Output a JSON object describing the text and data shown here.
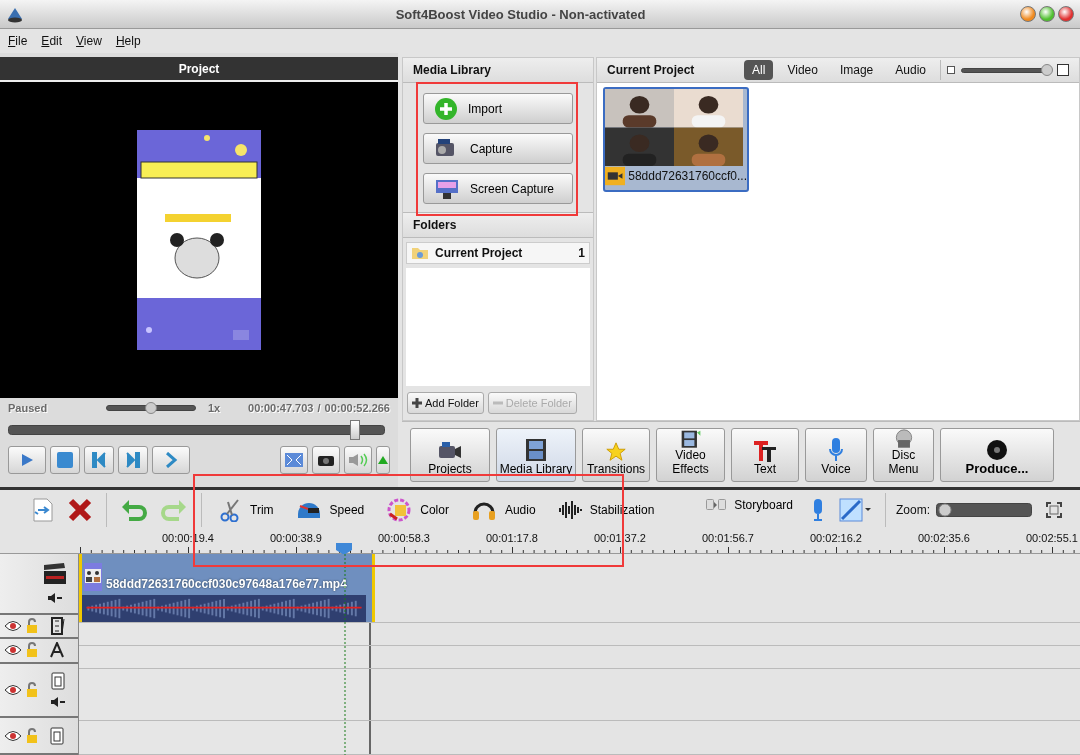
{
  "window": {
    "title": "Soft4Boost Video Studio - Non-activated"
  },
  "menu": [
    "File",
    "Edit",
    "View",
    "Help"
  ],
  "preview": {
    "title": "Project",
    "status": "Paused",
    "speed": {
      "level": 0.5
    },
    "speed_label": "1x",
    "current_time": "00:00:47.703",
    "separator": "/",
    "total_time": "00:00:52.266",
    "seek": {
      "level": 0.92
    }
  },
  "media_library": {
    "title": "Media Library",
    "buttons": [
      {
        "label": "Import",
        "kind": "import"
      },
      {
        "label": "Capture",
        "kind": "capture"
      },
      {
        "label": "Screen Capture",
        "kind": "screen"
      }
    ],
    "folders_title": "Folders",
    "folders": [
      {
        "name": "Current Project",
        "count": "1"
      }
    ],
    "folder_buttons": [
      {
        "label": "Add Folder",
        "kind": "add",
        "disabled": false
      },
      {
        "label": "Delete Folder",
        "kind": "delete",
        "disabled": true
      }
    ]
  },
  "current_project": {
    "title": "Current Project",
    "filters": [
      {
        "label": "All",
        "selected": true
      },
      {
        "label": "Video",
        "selected": false
      },
      {
        "label": "Image",
        "selected": false
      },
      {
        "label": "Audio",
        "selected": false
      }
    ],
    "thumb_size": {
      "level": 0.96
    },
    "items": [
      {
        "name": "58ddd72631760ccf0...",
        "selected": true
      }
    ]
  },
  "modules": [
    {
      "label": "Projects",
      "kind": "projects",
      "selected": false
    },
    {
      "label": "Media Library",
      "kind": "library",
      "selected": true
    },
    {
      "label": "Transitions",
      "kind": "transitions",
      "selected": false
    },
    {
      "label": "Video Effects",
      "kind": "effects",
      "selected": false
    },
    {
      "label": "Text",
      "kind": "text",
      "selected": false
    },
    {
      "label": "Voice",
      "kind": "voice",
      "selected": false
    },
    {
      "label": "Disc Menu",
      "kind": "disc",
      "selected": false
    },
    {
      "label": "Produce...",
      "kind": "produce",
      "selected": false
    }
  ],
  "timeline_toolbar": {
    "tools": [
      {
        "label": "Trim",
        "kind": "trim"
      },
      {
        "label": "Speed",
        "kind": "speed"
      },
      {
        "label": "Color",
        "kind": "color"
      },
      {
        "label": "Audio",
        "kind": "audio"
      },
      {
        "label": "Stabilization",
        "kind": "stabilization"
      }
    ],
    "storyboard": "Storyboard",
    "zoom_label": "Zoom:",
    "zoom": {
      "level": 0.03
    }
  },
  "timeline": {
    "ruler": [
      "00:00:19.4",
      "00:00:38.9",
      "00:00:58.3",
      "00:01:17.8",
      "00:01:37.2",
      "00:01:56.7",
      "00:02:16.2",
      "00:02:35.6",
      "00:02:55.1"
    ],
    "clip": {
      "name": "58ddd72631760ccf030c97648a176e77.mp4"
    },
    "tracks": [
      {
        "kind": "video"
      },
      {
        "kind": "effects"
      },
      {
        "kind": "text"
      },
      {
        "kind": "overlay"
      },
      {
        "kind": "video2"
      }
    ]
  }
}
